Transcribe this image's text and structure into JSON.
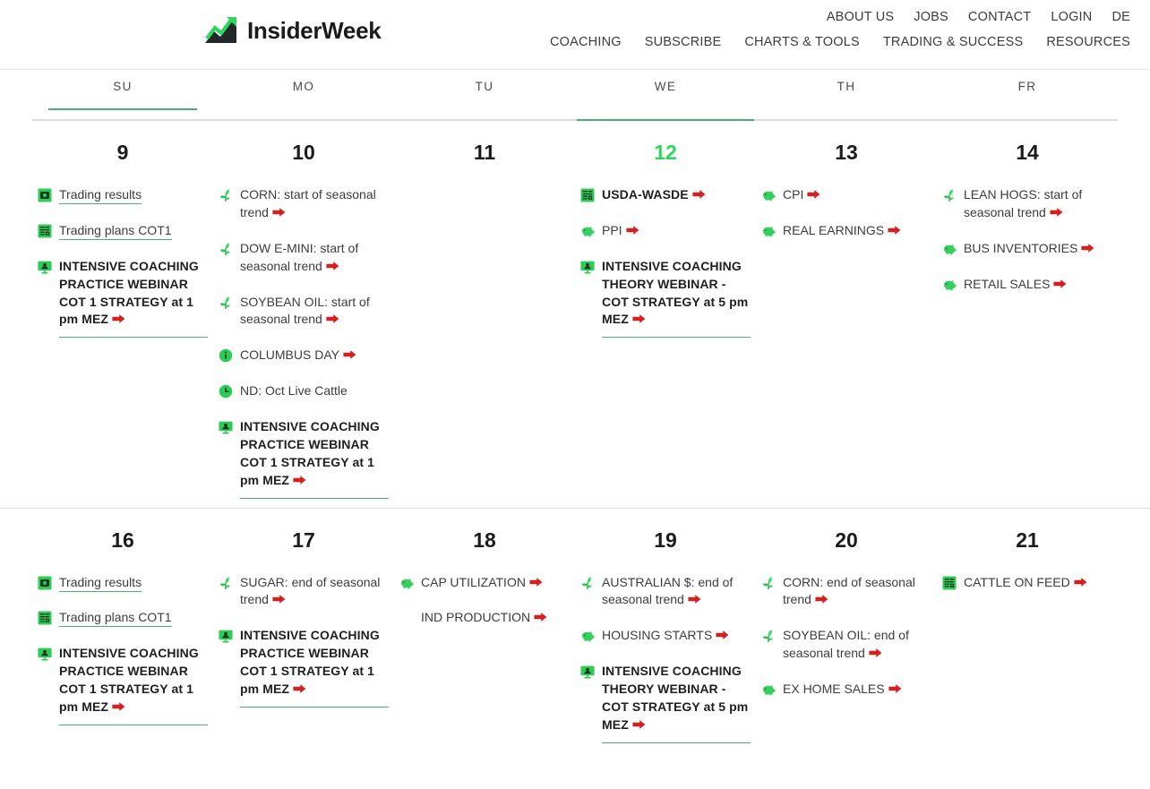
{
  "header": {
    "brand": {
      "name": "InsiderWeek",
      "logo_icon": "growth-chart-arrow-icon",
      "accent_color": "#2ed65e"
    },
    "top_nav": [
      {
        "label": "ABOUT US"
      },
      {
        "label": "JOBS"
      },
      {
        "label": "CONTACT"
      },
      {
        "label": "LOGIN"
      },
      {
        "label": "DE"
      }
    ],
    "main_nav": [
      {
        "label": "COACHING"
      },
      {
        "label": "SUBSCRIBE"
      },
      {
        "label": "CHARTS & TOOLS"
      },
      {
        "label": "TRADING & SUCCESS"
      },
      {
        "label": "RESOURCES"
      }
    ]
  },
  "calendar": {
    "accent_color": "#4caf6d",
    "today_color": "#2ed65e",
    "arrow_color": "#d62020",
    "weekdays": [
      {
        "label": "SU",
        "marked": true
      },
      {
        "label": "MO",
        "marked": false
      },
      {
        "label": "TU",
        "marked": false
      },
      {
        "label": "WE",
        "marked": false
      },
      {
        "label": "TH",
        "marked": false
      },
      {
        "label": "FR",
        "marked": false
      }
    ],
    "rule_accent_column_index": 3,
    "weeks": [
      {
        "days": [
          {
            "number": "9",
            "is_today": false,
            "events": [
              {
                "icon": "video-play-icon",
                "text": "Trading results",
                "bold": false,
                "underlined": true,
                "arrow": false,
                "rule": false
              },
              {
                "icon": "report-document-icon",
                "text": "Trading plans COT1",
                "bold": false,
                "underlined": true,
                "arrow": false,
                "rule": false
              },
              {
                "icon": "webinar-monitor-icon",
                "text": "INTENSIVE COACHING PRACTICE WEBINAR COT 1 STRATEGY at 1 pm MEZ",
                "bold": true,
                "underlined": false,
                "arrow": true,
                "rule": true
              }
            ]
          },
          {
            "number": "10",
            "is_today": false,
            "events": [
              {
                "icon": "sprout-icon",
                "text": "CORN: start of seasonal trend",
                "bold": false,
                "underlined": false,
                "arrow": true,
                "rule": false
              },
              {
                "icon": "sprout-icon",
                "text": "DOW E-MINI: start of seasonal trend",
                "bold": false,
                "underlined": false,
                "arrow": true,
                "rule": false
              },
              {
                "icon": "sprout-icon",
                "text": "SOYBEAN OIL: start of seasonal trend",
                "bold": false,
                "underlined": false,
                "arrow": true,
                "rule": false
              },
              {
                "icon": "info-circle-icon",
                "text": "COLUMBUS DAY",
                "bold": false,
                "underlined": false,
                "arrow": true,
                "rule": false
              },
              {
                "icon": "clock-circle-icon",
                "text": "ND: Oct Live Cattle",
                "bold": false,
                "underlined": false,
                "arrow": false,
                "rule": false
              },
              {
                "icon": "webinar-monitor-icon",
                "text": "INTENSIVE COACHING PRACTICE WEBINAR COT 1 STRATEGY at 1 pm MEZ",
                "bold": true,
                "underlined": false,
                "arrow": true,
                "rule": true
              }
            ]
          },
          {
            "number": "11",
            "is_today": false,
            "events": []
          },
          {
            "number": "12",
            "is_today": true,
            "events": [
              {
                "icon": "report-document-icon",
                "text": "USDA-WASDE",
                "bold": true,
                "underlined": false,
                "arrow": true,
                "rule": false
              },
              {
                "icon": "piggy-bank-icon",
                "text": "PPI",
                "bold": false,
                "underlined": false,
                "arrow": true,
                "rule": false
              },
              {
                "icon": "webinar-monitor-icon",
                "text": "INTENSIVE COACHING THEORY WEBINAR - COT STRATEGY at 5 pm MEZ",
                "bold": true,
                "underlined": false,
                "arrow": true,
                "rule": true
              }
            ]
          },
          {
            "number": "13",
            "is_today": false,
            "events": [
              {
                "icon": "piggy-bank-icon",
                "text": "CPI",
                "bold": false,
                "underlined": false,
                "arrow": true,
                "rule": false
              },
              {
                "icon": "piggy-bank-icon",
                "text": "REAL EARNINGS",
                "bold": false,
                "underlined": false,
                "arrow": true,
                "rule": false
              }
            ]
          },
          {
            "number": "14",
            "is_today": false,
            "events": [
              {
                "icon": "sprout-icon",
                "text": "LEAN HOGS: start of seasonal trend",
                "bold": false,
                "underlined": false,
                "arrow": true,
                "rule": false
              },
              {
                "icon": "piggy-bank-icon",
                "text": "BUS INVENTORIES",
                "bold": false,
                "underlined": false,
                "arrow": true,
                "rule": false
              },
              {
                "icon": "piggy-bank-icon",
                "text": "RETAIL SALES",
                "bold": false,
                "underlined": false,
                "arrow": true,
                "rule": false
              }
            ]
          }
        ]
      },
      {
        "days": [
          {
            "number": "16",
            "is_today": false,
            "events": [
              {
                "icon": "video-play-icon",
                "text": "Trading results",
                "bold": false,
                "underlined": true,
                "arrow": false,
                "rule": false
              },
              {
                "icon": "report-document-icon",
                "text": "Trading plans COT1",
                "bold": false,
                "underlined": true,
                "arrow": false,
                "rule": false
              },
              {
                "icon": "webinar-monitor-icon",
                "text": "INTENSIVE COACHING PRACTICE WEBINAR COT 1 STRATEGY at 1 pm MEZ",
                "bold": true,
                "underlined": false,
                "arrow": true,
                "rule": true
              }
            ]
          },
          {
            "number": "17",
            "is_today": false,
            "events": [
              {
                "icon": "sprout-icon",
                "text": "SUGAR: end of seasonal trend",
                "bold": false,
                "underlined": false,
                "arrow": true,
                "rule": false
              },
              {
                "icon": "webinar-monitor-icon",
                "text": "INTENSIVE COACHING PRACTICE WEBINAR COT 1 STRATEGY at 1 pm MEZ",
                "bold": true,
                "underlined": false,
                "arrow": true,
                "rule": true
              }
            ]
          },
          {
            "number": "18",
            "is_today": false,
            "events": [
              {
                "icon": "piggy-bank-icon",
                "text": "CAP UTILIZATION",
                "bold": false,
                "underlined": false,
                "arrow": true,
                "rule": false
              },
              {
                "icon": "none",
                "text": "IND PRODUCTION",
                "bold": false,
                "underlined": false,
                "arrow": true,
                "rule": false
              }
            ]
          },
          {
            "number": "19",
            "is_today": false,
            "events": [
              {
                "icon": "sprout-icon",
                "text": "AUSTRALIAN $: end of seasonal trend",
                "bold": false,
                "underlined": false,
                "arrow": true,
                "rule": false
              },
              {
                "icon": "piggy-bank-icon",
                "text": "HOUSING STARTS",
                "bold": false,
                "underlined": false,
                "arrow": true,
                "rule": false
              },
              {
                "icon": "webinar-monitor-icon",
                "text": "INTENSIVE COACHING THEORY WEBINAR - COT STRATEGY at 5 pm MEZ",
                "bold": true,
                "underlined": false,
                "arrow": true,
                "rule": true
              }
            ]
          },
          {
            "number": "20",
            "is_today": false,
            "events": [
              {
                "icon": "sprout-icon",
                "text": "CORN: end of seasonal trend",
                "bold": false,
                "underlined": false,
                "arrow": true,
                "rule": false
              },
              {
                "icon": "sprout-icon",
                "text": "SOYBEAN OIL: end of seasonal trend",
                "bold": false,
                "underlined": false,
                "arrow": true,
                "rule": false
              },
              {
                "icon": "piggy-bank-icon",
                "text": "EX HOME SALES",
                "bold": false,
                "underlined": false,
                "arrow": true,
                "rule": false
              }
            ]
          },
          {
            "number": "21",
            "is_today": false,
            "events": [
              {
                "icon": "report-document-icon",
                "text": "CATTLE ON FEED",
                "bold": false,
                "underlined": false,
                "arrow": true,
                "rule": false
              }
            ]
          }
        ]
      }
    ]
  }
}
